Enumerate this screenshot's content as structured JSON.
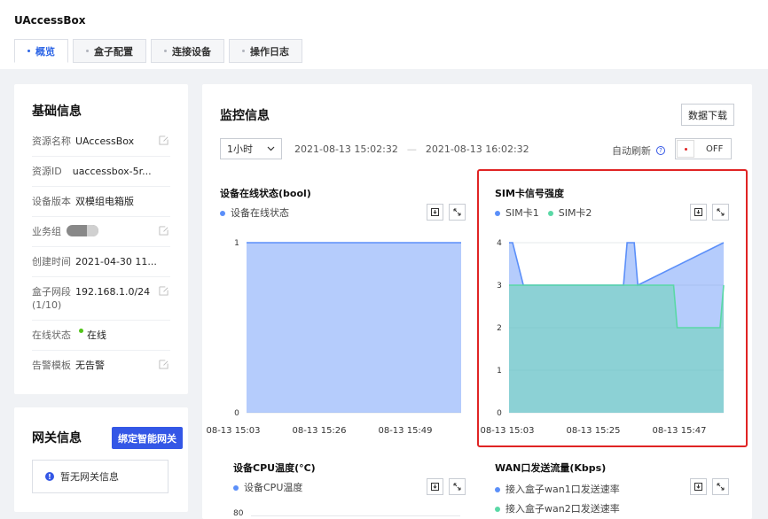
{
  "app": {
    "title": "UAccessBox"
  },
  "tabs": [
    {
      "label": "概览",
      "active": true
    },
    {
      "label": "盒子配置",
      "active": false
    },
    {
      "label": "连接设备",
      "active": false
    },
    {
      "label": "操作日志",
      "active": false
    }
  ],
  "basic_info": {
    "title": "基础信息",
    "rows": [
      {
        "label": "资源名称",
        "value": "UAccessBox",
        "editable": true
      },
      {
        "label": "资源ID",
        "value": "uaccessbox-5r...",
        "editable": false
      },
      {
        "label": "设备版本",
        "value": "双模组电箱版",
        "editable": false
      },
      {
        "label": "业务组",
        "value": "",
        "editable": true
      },
      {
        "label": "创建时间",
        "value": "2021-04-30 11...",
        "editable": false
      },
      {
        "label": "盒子网段",
        "value": "192.168.1.0/24",
        "note": "(1/10)",
        "editable": true
      },
      {
        "label": "在线状态",
        "value": "在线",
        "editable": false
      },
      {
        "label": "告警模板",
        "value": "无告警",
        "editable": true
      }
    ]
  },
  "gateway": {
    "title": "网关信息",
    "bind_button": "绑定智能网关",
    "empty_text": "暂无网关信息"
  },
  "monitor": {
    "title": "监控信息",
    "download_button": "数据下载",
    "range_select": "1小时",
    "start_time": "2021-08-13 15:02:32",
    "separator": "—",
    "end_time": "2021-08-13 16:02:32",
    "auto_refresh_label": "自动刷新",
    "toggle_state": "OFF"
  },
  "colors": {
    "accent": "#2e66e6",
    "button_primary": "#3457e6",
    "series_blue": "#5b8ff9",
    "series_green": "#5ad8a6",
    "highlight": "#e02424",
    "online": "#52c41a"
  },
  "chart_data": [
    {
      "type": "area",
      "title": "设备在线状态(bool)",
      "x_ticks": [
        "08-13 15:03",
        "08-13 15:26",
        "08-13 15:49"
      ],
      "y_ticks": [
        "1",
        "0"
      ],
      "ylim": [
        0,
        1
      ],
      "series": [
        {
          "name": "设备在线状态",
          "color": "#5b8ff9",
          "x": [
            0,
            60
          ],
          "values": [
            1,
            1
          ]
        }
      ]
    },
    {
      "type": "area",
      "title": "SIM卡信号强度",
      "x_ticks": [
        "08-13 15:03",
        "08-13 15:25",
        "08-13 15:47"
      ],
      "y_ticks": [
        "4",
        "3",
        "2",
        "1",
        "0"
      ],
      "ylim": [
        0,
        4
      ],
      "series": [
        {
          "name": "SIM卡1",
          "color": "#5b8ff9",
          "x": [
            0,
            1,
            4,
            32,
            33,
            35,
            36,
            60
          ],
          "values": [
            4,
            4,
            3,
            3,
            4,
            4,
            3,
            4
          ]
        },
        {
          "name": "SIM卡2",
          "color": "#5ad8a6",
          "x": [
            0,
            46,
            47,
            59,
            60
          ],
          "values": [
            3,
            3,
            2,
            2,
            3
          ]
        }
      ]
    },
    {
      "type": "line",
      "title": "设备CPU温度(°C)",
      "y_ticks": [
        "80"
      ],
      "series": [
        {
          "name": "设备CPU温度",
          "color": "#5b8ff9"
        }
      ]
    },
    {
      "type": "line",
      "title": "WAN口发送流量(Kbps)",
      "series": [
        {
          "name": "接入盒子wan1口发送速率",
          "color": "#5b8ff9"
        },
        {
          "name": "接入盒子wan2口发送速率",
          "color": "#5ad8a6"
        }
      ]
    }
  ]
}
